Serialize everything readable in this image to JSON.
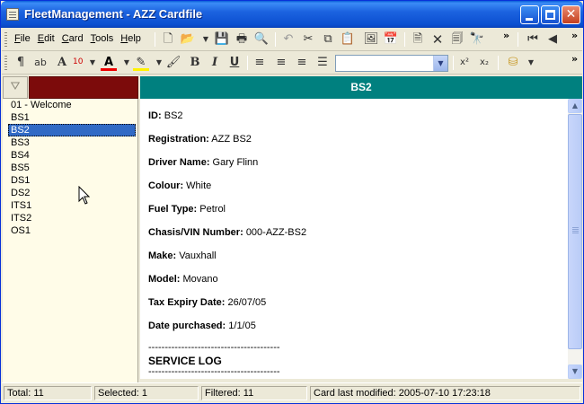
{
  "window": {
    "title": "FleetManagement - AZZ Cardfile"
  },
  "menu": [
    "File",
    "Edit",
    "Card",
    "Tools",
    "Help"
  ],
  "format_toolbar": {
    "font_size": "10",
    "style_value": ""
  },
  "list": {
    "items": [
      "01 - Welcome",
      "BS1",
      "BS2",
      "BS3",
      "BS4",
      "BS5",
      "DS1",
      "DS2",
      "ITS1",
      "ITS2",
      "OS1"
    ],
    "selected": "BS2"
  },
  "card": {
    "header": "BS2",
    "fields": [
      {
        "label": "ID:",
        "value": "BS2"
      },
      {
        "label": "Registration:",
        "value": "AZZ BS2"
      },
      {
        "label": "Driver Name:",
        "value": "Gary Flinn"
      },
      {
        "label": "Colour:",
        "value": "White"
      },
      {
        "label": "Fuel Type:",
        "value": "Petrol"
      },
      {
        "label": "Chasis/VIN Number:",
        "value": "000-AZZ-BS2"
      },
      {
        "label": "Make:",
        "value": "Vauxhall"
      },
      {
        "label": "Model:",
        "value": "Movano"
      },
      {
        "label": "Tax Expiry Date:",
        "value": "26/07/05"
      },
      {
        "label": "Date purchased:",
        "value": "1/1/05"
      }
    ],
    "divider": "----------------------------------------",
    "section_title": "SERVICE LOG"
  },
  "status": {
    "total": "Total: 11",
    "selected": "Selected: 1",
    "filtered": "Filtered: 11",
    "modified": "Card last modified: 2005-07-10  17:23:18"
  },
  "colors": {
    "titlebar": "#0B4FD0",
    "card_header": "#00807F",
    "filter_field": "#7C0B0B",
    "list_bg": "#FFFCE8",
    "selection": "#316AC5"
  }
}
